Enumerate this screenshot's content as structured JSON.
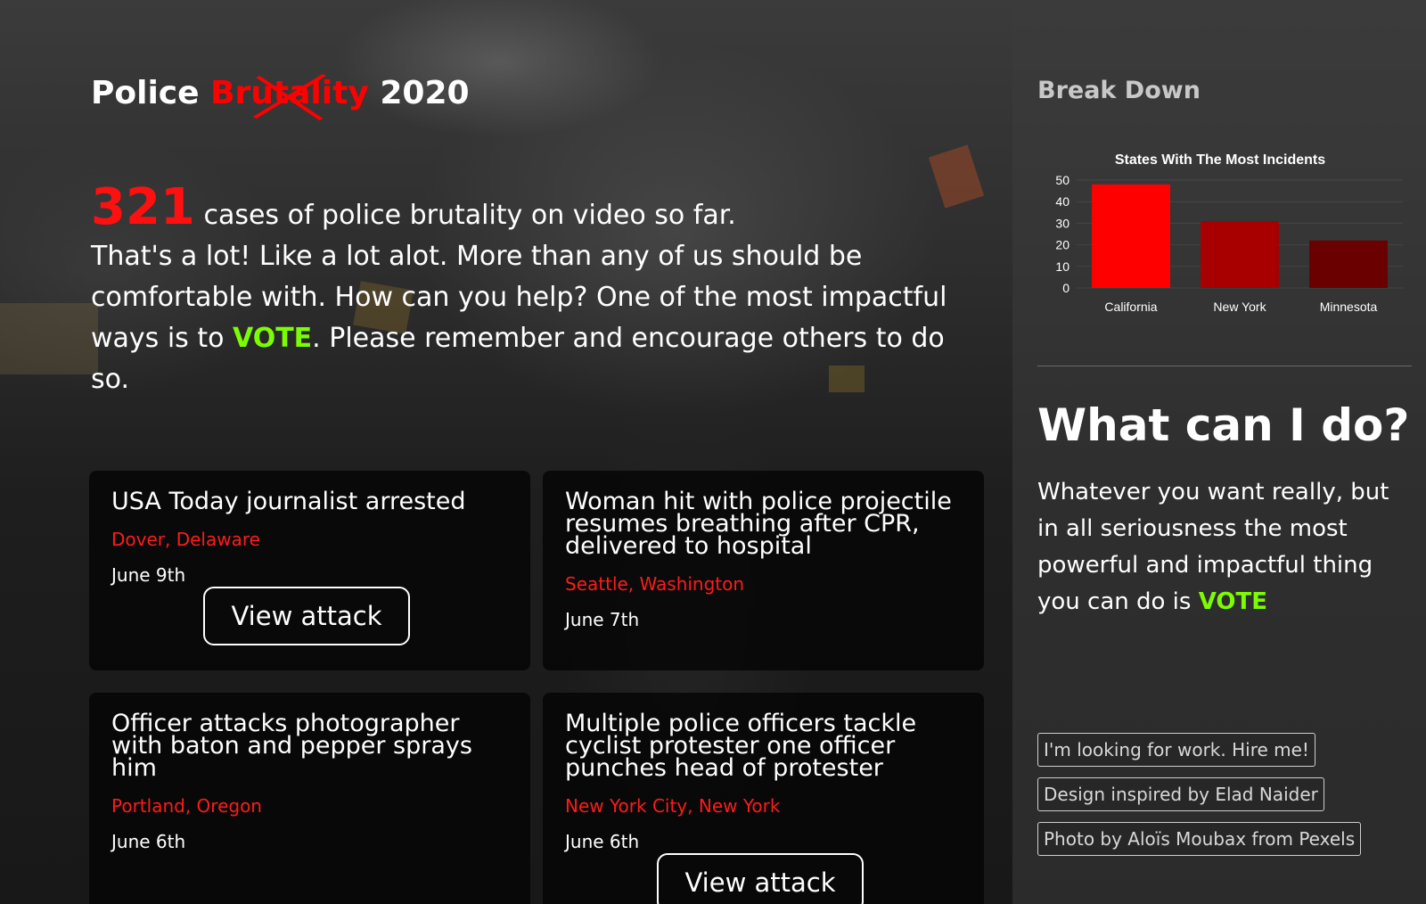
{
  "header": {
    "title_prefix": "Police",
    "title_struck": "Brutality",
    "title_suffix": "2020"
  },
  "intro": {
    "count": "321",
    "count_text": "cases of police brutality on video so far.",
    "body_before_vote": "That's a lot! Like a lot alot. More than any of us should be comfortable with. How can you help? One of the most impactful ways is to",
    "vote": "VOTE",
    "body_after_vote": ". Please remember and encourage others to do so."
  },
  "cards": [
    {
      "title": "USA Today journalist arrested",
      "location": "Dover, Delaware",
      "date": "June 9th",
      "button": "View attack"
    },
    {
      "title": "Woman hit with police projectile resumes breathing after CPR, delivered to hospital",
      "location": "Seattle, Washington",
      "date": "June 7th"
    },
    {
      "title": "Officer attacks photographer with baton and pepper sprays him",
      "location": "Portland, Oregon",
      "date": "June 6th"
    },
    {
      "title": "Multiple police officers tackle cyclist protester one officer punches head of protester",
      "location": "New York City, New York",
      "date": "June 6th",
      "button": "View attack"
    }
  ],
  "sidebar": {
    "title": "Break Down",
    "heading": "What can I do?",
    "text_before_vote": "Whatever you want really, but in all seriousness the most powerful and impactful thing you can do is",
    "vote": "VOTE",
    "credits": [
      "I'm looking for work. Hire me!",
      "Design inspired by Elad Naider",
      "Photo by Aloïs Moubax from Pexels"
    ]
  },
  "colors": {
    "accent_red": "#ff0000",
    "vote_green": "#7cfc00"
  },
  "chart_data": {
    "type": "bar",
    "title": "States With The Most Incidents",
    "categories": [
      "California",
      "New York",
      "Minnesota"
    ],
    "values": [
      48,
      31,
      22
    ],
    "colors": [
      "#ff0000",
      "#a80000",
      "#6b0000"
    ],
    "ylim": [
      0,
      50
    ],
    "yticks": [
      0,
      10,
      20,
      30,
      40,
      50
    ],
    "legend": "none"
  }
}
